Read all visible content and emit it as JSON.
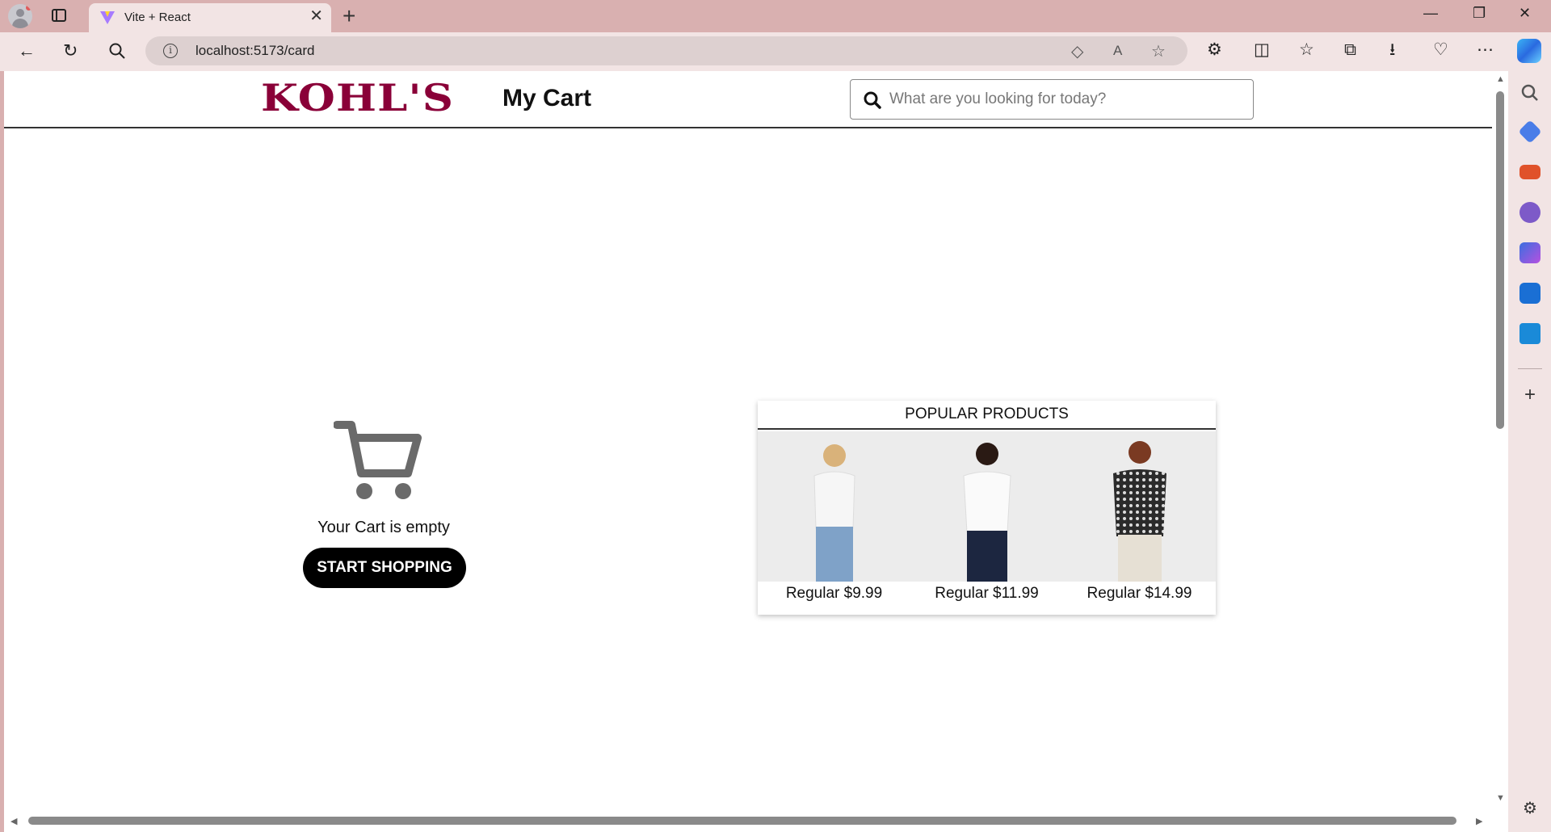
{
  "browser": {
    "tab_title": "Vite + React",
    "url": "localhost:5173/card",
    "new_tab_symbol": "+",
    "tab_close_symbol": "✕",
    "window_controls": {
      "minimize": "—",
      "maximize": "❐",
      "close": "✕"
    }
  },
  "header": {
    "logo_text": "KOHL'S",
    "title": "My Cart",
    "search_placeholder": "What are you looking for today?"
  },
  "empty_cart": {
    "message": "Your Cart is empty",
    "button_label": "START SHOPPING"
  },
  "popular_products": {
    "title": "POPULAR PRODUCTS",
    "items": [
      {
        "price": "Regular $9.99",
        "shirt_color": "#f4f4f4",
        "pants_color": "#7fa2c8"
      },
      {
        "price": "Regular $11.99",
        "shirt_color": "#fafafa",
        "pants_color": "#1c2640"
      },
      {
        "price": "Regular $14.99",
        "shirt_color": "#2b2b2b",
        "pants_color": "#e6e0d4"
      }
    ]
  },
  "colors": {
    "brand": "#8a0038",
    "chrome": "#d9b0b0",
    "toolbar": "#f2e4e4"
  }
}
